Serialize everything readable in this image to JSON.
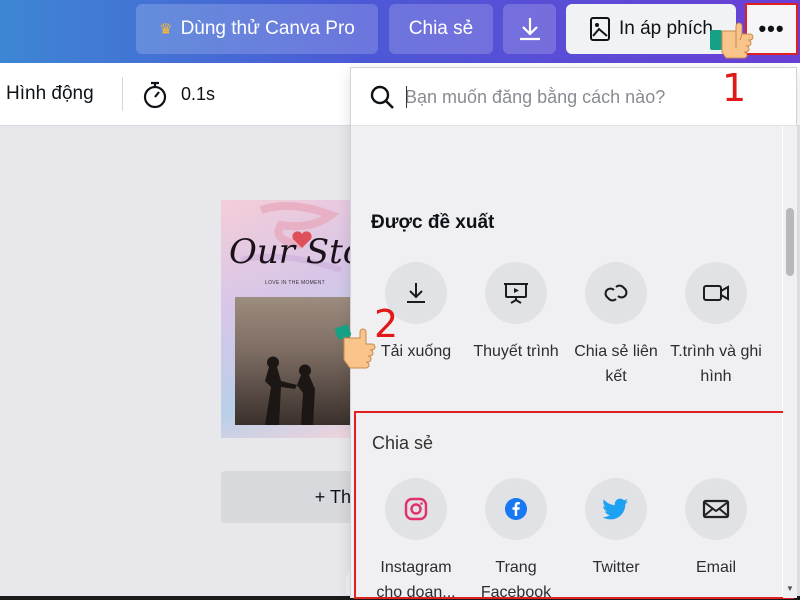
{
  "topbar": {
    "pro_label": "Dùng thử Canva Pro",
    "share_label": "Chia sẻ",
    "print_label": "In áp phích",
    "more_label": "•••"
  },
  "toolbar": {
    "animate_label": "Hình động",
    "duration": "0.1s"
  },
  "canvas": {
    "poster_title": "Our Story",
    "poster_subtitle": "LOVE IN THE MOMENT",
    "add_page_label": "+ Th",
    "page_toggle": "^"
  },
  "panel": {
    "search_placeholder": "Bạn muốn đăng bằng cách nào?",
    "suggested_title": "Được đề xuất",
    "suggested": [
      {
        "label": "Tải xuống",
        "icon": "download-icon"
      },
      {
        "label": "Thuyết trình",
        "icon": "present-icon"
      },
      {
        "label": "Chia sẻ liên kết",
        "icon": "link-icon"
      },
      {
        "label": "T.trình và ghi hình",
        "icon": "video-icon"
      }
    ],
    "share_title": "Chia sẻ",
    "share": [
      {
        "label": "Instagram cho doan...",
        "icon": "instagram-icon",
        "color": "#e1306c"
      },
      {
        "label": "Trang Facebook",
        "icon": "facebook-icon",
        "color": "#1877f2"
      },
      {
        "label": "Twitter",
        "icon": "twitter-icon",
        "color": "#1da1f2"
      },
      {
        "label": "Email",
        "icon": "email-icon",
        "color": "#222222"
      }
    ]
  },
  "annotations": {
    "step1": "1",
    "step2": "2"
  },
  "colors": {
    "accent_red": "#e02020",
    "topbar_gradient_start": "#3d86d4",
    "topbar_gradient_end": "#6a3fd6"
  }
}
